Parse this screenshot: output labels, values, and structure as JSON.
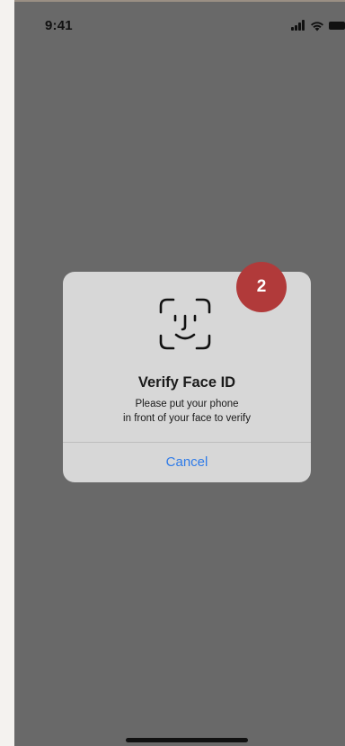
{
  "status_bar": {
    "time": "9:41",
    "icons": [
      "signal-icon",
      "wifi-icon",
      "battery-icon"
    ]
  },
  "dialog": {
    "icon": "face-id-icon",
    "title": "Verify Face ID",
    "message_line1": "Please put your phone",
    "message_line2": "in front of your face to verify",
    "cancel_label": "Cancel"
  },
  "step_badge": {
    "label": "2",
    "color": "#b13a3a"
  },
  "colors": {
    "background_dim": "#696969",
    "dialog_bg": "#d7d7d7",
    "action_blue": "#2f7be8"
  }
}
